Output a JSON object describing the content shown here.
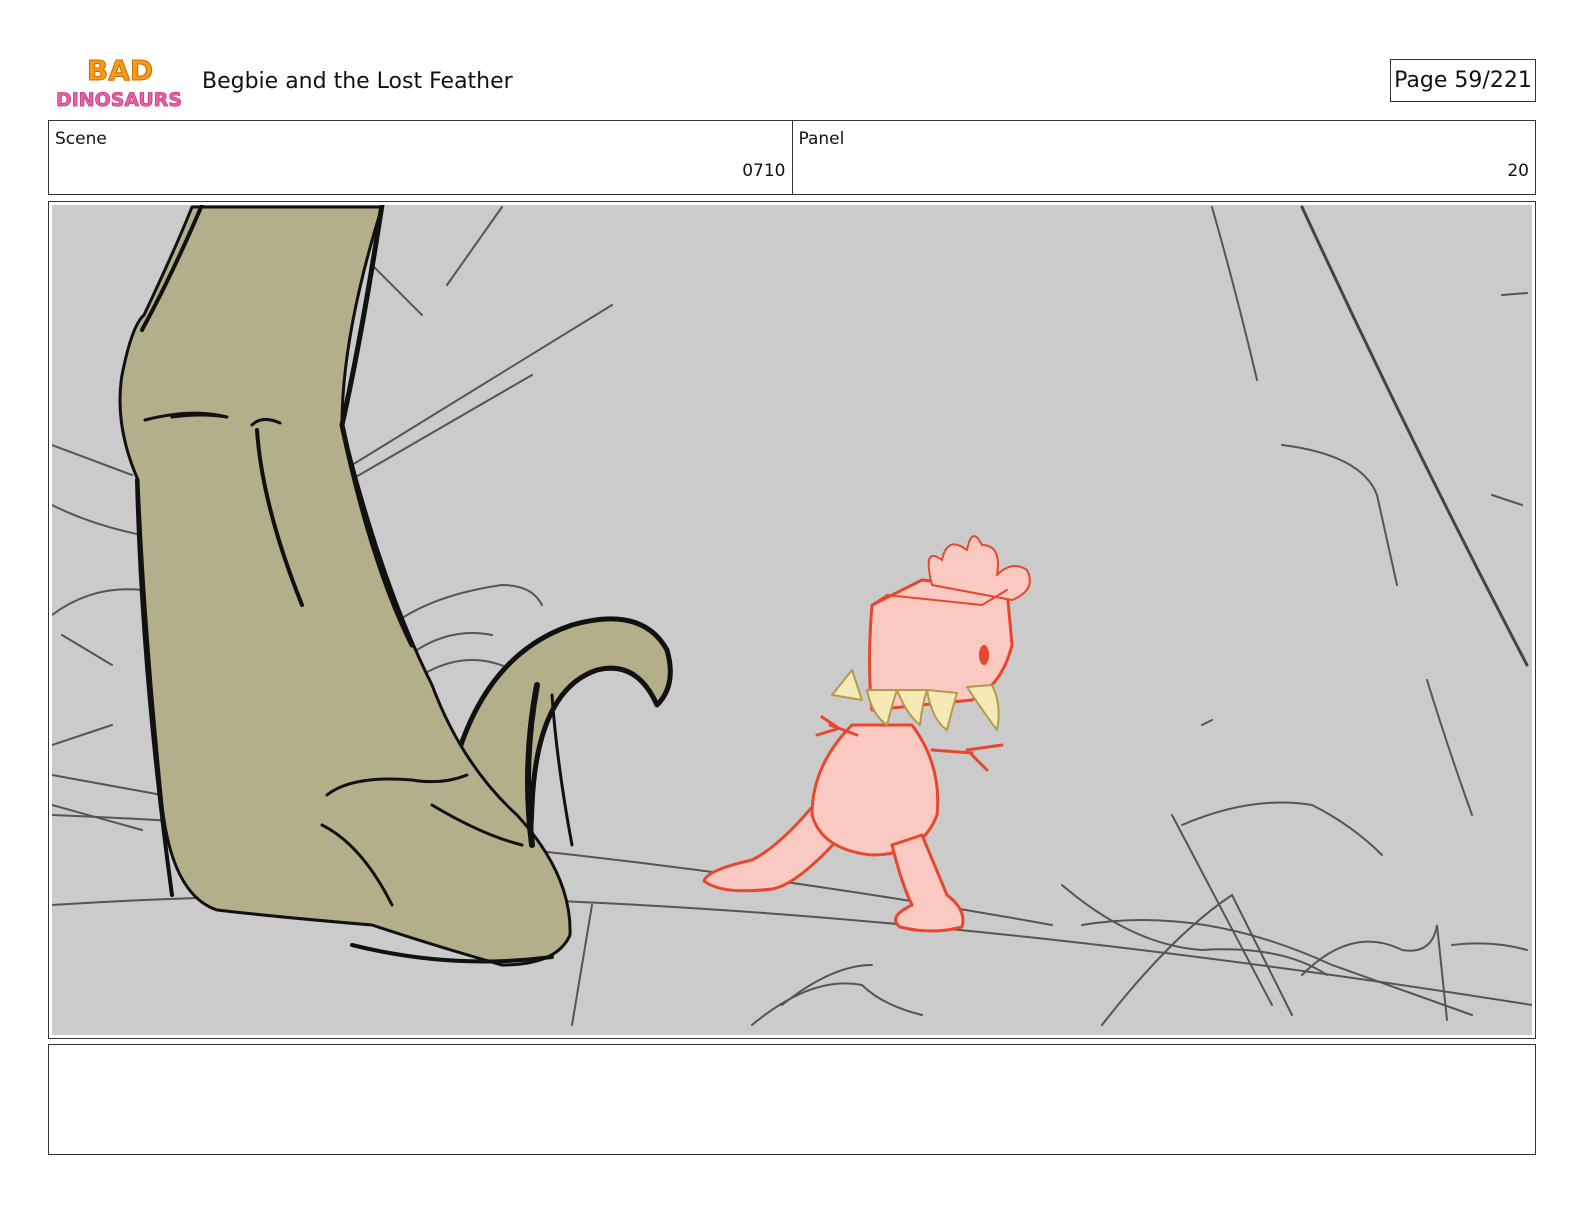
{
  "header": {
    "logo_text_top": "BAD",
    "logo_text_bottom": "DINOSAURS",
    "title": "Begbie and the Lost Feather",
    "page_label": "Page",
    "page_number": "59/221"
  },
  "scene": {
    "label": "Scene",
    "value": "0710"
  },
  "panel": {
    "label": "Panel",
    "value": "20"
  },
  "notes": {
    "text": ""
  },
  "colors": {
    "frame_background": "#cbcbcb",
    "dino_leg": "#b3af8b",
    "small_dino_fill": "#f9c9c2",
    "small_dino_line": "#e8472f",
    "teeth": "#f3eab8"
  }
}
